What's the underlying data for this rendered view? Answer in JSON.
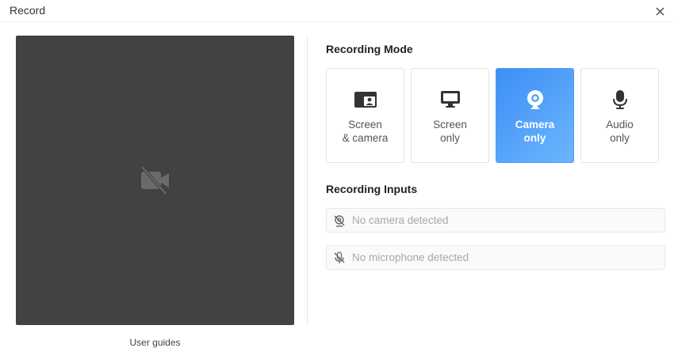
{
  "window": {
    "title": "Record"
  },
  "preview": {
    "guides_label": "User guides"
  },
  "recording_mode": {
    "heading": "Recording Mode",
    "options": [
      {
        "label": "Screen\n& camera",
        "icon": "screen-camera-icon",
        "active": false
      },
      {
        "label": "Screen\nonly",
        "icon": "monitor-icon",
        "active": false
      },
      {
        "label": "Camera\nonly",
        "icon": "webcam-icon",
        "active": true
      },
      {
        "label": "Audio\nonly",
        "icon": "microphone-icon",
        "active": false
      }
    ]
  },
  "recording_inputs": {
    "heading": "Recording Inputs",
    "camera": {
      "text": "No camera detected",
      "icon": "camera-off-icon"
    },
    "microphone": {
      "text": "No microphone detected",
      "icon": "microphone-off-icon"
    }
  },
  "colors": {
    "accent": "#4a9cf8",
    "preview_bg": "#424242"
  }
}
